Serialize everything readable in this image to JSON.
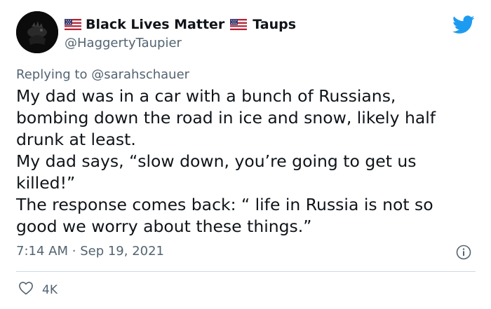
{
  "tweet": {
    "author": {
      "name_part_1": "Black Lives Matter",
      "name_part_2": "Taups",
      "handle": "@HaggertyTaupier",
      "flag_icon": "us-flag-icon"
    },
    "replying_prefix": "Replying to",
    "replying_to": "@sarahschauer",
    "body_lines": [
      "My dad was in a car with a bunch of Russians,",
      "bombing down the road in ice and snow, likely half",
      "drunk at least.",
      "My dad says, “slow down, you’re going to get us",
      "killed!”",
      "The response comes back: “ life in Russia is not so",
      "good we worry about these things.”"
    ],
    "time": "7:14 AM",
    "separator": "·",
    "date": "Sep 19, 2021",
    "likes": "4K"
  },
  "colors": {
    "twitter_blue": "#1d9bf0",
    "secondary_text": "#536471",
    "primary_text": "#0f1419",
    "divider": "#cfd9de"
  },
  "icons": {
    "logo": "twitter-bird-icon",
    "info": "info-icon",
    "like": "heart-outline-icon"
  }
}
